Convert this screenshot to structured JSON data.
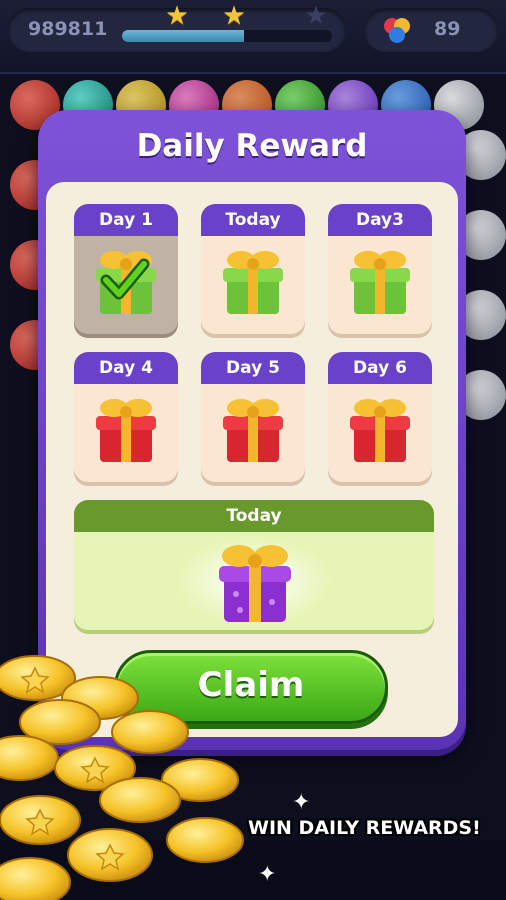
{
  "hud": {
    "score": "989811",
    "score_progress": 0.58,
    "stars": [
      {
        "state": "earned",
        "icon": "star-icon"
      },
      {
        "state": "earned",
        "icon": "star-icon"
      },
      {
        "state": "empty",
        "icon": "star-icon"
      }
    ],
    "gems": "89",
    "gem_icon": "color-balls-icon"
  },
  "dialog": {
    "title": "Daily Reward",
    "days": [
      {
        "label": "Day 1",
        "status": "claimed",
        "icon": "gift-green-icon"
      },
      {
        "label": "Today",
        "status": "available",
        "icon": "gift-green-icon"
      },
      {
        "label": "Day3",
        "status": "locked",
        "icon": "gift-green-icon"
      },
      {
        "label": "Day 4",
        "status": "locked",
        "icon": "gift-red-icon"
      },
      {
        "label": "Day 5",
        "status": "locked",
        "icon": "gift-red-icon"
      },
      {
        "label": "Day 6",
        "status": "locked",
        "icon": "gift-red-icon"
      }
    ],
    "big_reward": {
      "label": "Today",
      "icon": "gift-purple-icon"
    },
    "claim_label": "Claim"
  },
  "promo": {
    "caption": "WIN DAILY REWARDS!"
  },
  "colors": {
    "dialog": "#6a41c9",
    "claim": "#4cbf1f",
    "big_card": "#69992c"
  }
}
